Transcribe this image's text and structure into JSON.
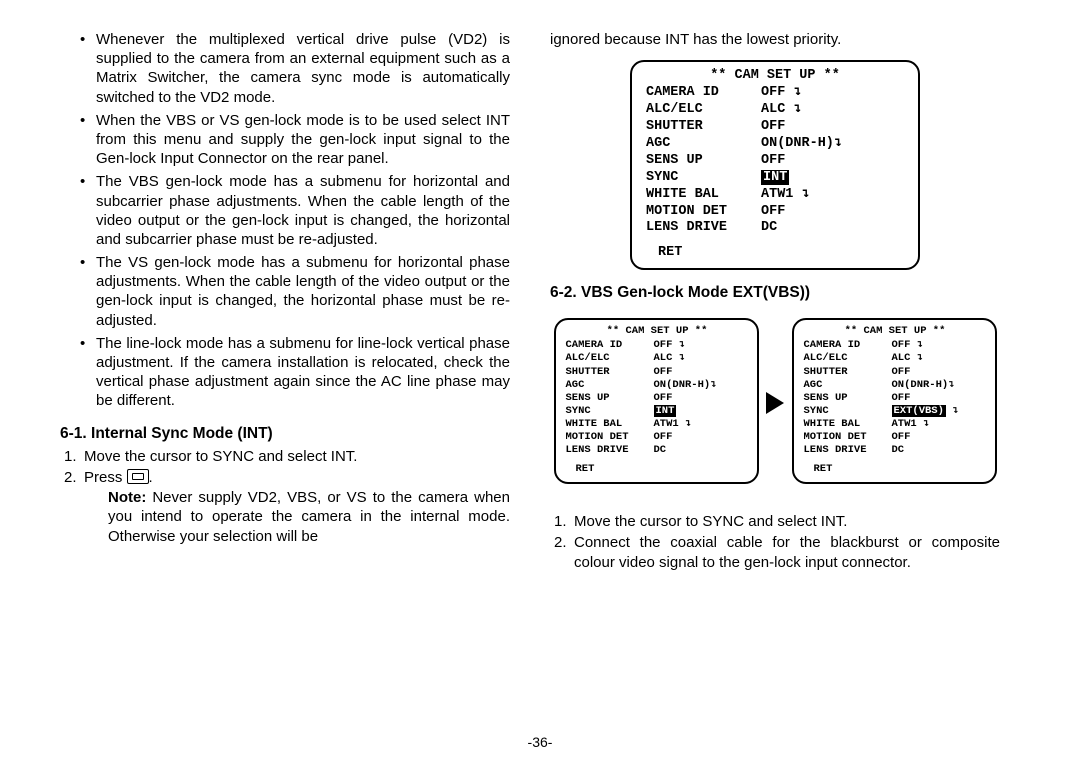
{
  "pageNumber": "-36-",
  "left": {
    "bullets": [
      "Whenever the multiplexed vertical drive pulse (VD2) is supplied to the camera from an external equipment such as a Matrix Switcher, the camera sync mode is automatically switched to the VD2 mode.",
      "When the VBS or VS gen-lock mode is to be used select INT from this menu and supply the gen-lock input signal to the Gen-lock Input Connector on the rear panel.",
      "The VBS gen-lock mode has a submenu for horizontal and subcarrier phase adjustments. When the cable length of the video output or the gen-lock input is changed, the horizontal and subcarrier phase must be re-adjusted.",
      "The VS gen-lock mode has a submenu for horizontal phase adjustments. When the cable length of the video output or the gen-lock input is changed, the horizontal phase must be re-adjusted.",
      "The line-lock mode has a submenu for line-lock vertical phase adjustment. If the camera installation is relocated, check the vertical phase adjustment again since the AC line phase may be different."
    ],
    "section61": {
      "heading": "6-1. Internal Sync Mode (INT)",
      "step1": "Move the cursor to SYNC and select INT.",
      "step2_prefix": "Press ",
      "step2_suffix": ".",
      "note_label": "Note:",
      "note_text": " Never supply VD2, VBS, or VS to the camera when you intend to operate the camera in the internal mode. Otherwise your selection will be"
    }
  },
  "right": {
    "topLine": "ignored because INT has the lowest priority.",
    "menuTitle": "** CAM SET UP **",
    "menuRows": [
      {
        "k": "CAMERA ID",
        "v": "OFF ↴"
      },
      {
        "k": "ALC/ELC",
        "v": "ALC ↴"
      },
      {
        "k": "SHUTTER",
        "v": "OFF"
      },
      {
        "k": "AGC",
        "v": "ON(DNR-H)↴"
      },
      {
        "k": "SENS UP",
        "v": "OFF"
      },
      {
        "k": "SYNC",
        "vSel": "INT"
      },
      {
        "k": "WHITE BAL",
        "v": "ATW1 ↴"
      },
      {
        "k": "MOTION DET",
        "v": "OFF"
      },
      {
        "k": "LENS DRIVE",
        "v": "DC"
      }
    ],
    "menuRows2": [
      {
        "k": "CAMERA ID",
        "v": "OFF ↴"
      },
      {
        "k": "ALC/ELC",
        "v": "ALC ↴"
      },
      {
        "k": "SHUTTER",
        "v": "OFF"
      },
      {
        "k": "AGC",
        "v": "ON(DNR-H)↴"
      },
      {
        "k": "SENS UP",
        "v": "OFF"
      },
      {
        "k": "SYNC",
        "vSel": "EXT(VBS)",
        "vAfter": " ↴"
      },
      {
        "k": "WHITE BAL",
        "v": "ATW1 ↴"
      },
      {
        "k": "MOTION DET",
        "v": "OFF"
      },
      {
        "k": "LENS DRIVE",
        "v": "DC"
      }
    ],
    "ret": "RET",
    "section62": {
      "heading": "6-2. VBS Gen-lock Mode EXT(VBS))",
      "step1": "Move the cursor to SYNC and select INT.",
      "step2": "Connect the coaxial cable for the blackburst or composite colour video signal to the gen-lock input connector."
    }
  }
}
